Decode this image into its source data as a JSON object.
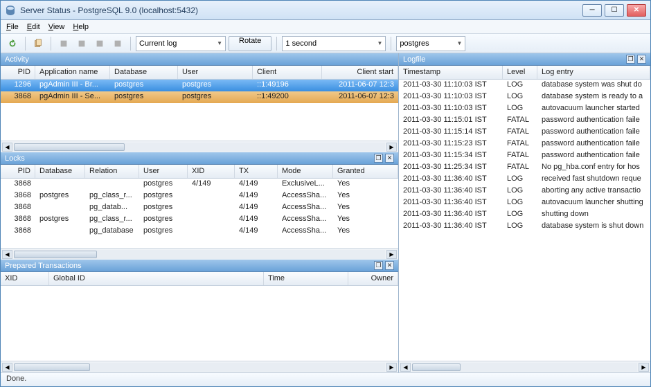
{
  "title": "Server Status - PostgreSQL 9.0 (localhost:5432)",
  "menu": {
    "file": "File",
    "edit": "Edit",
    "view": "View",
    "help": "Help"
  },
  "toolbar": {
    "currentlog": "Current log",
    "rotate": "Rotate",
    "refresh": "1 second",
    "database": "postgres"
  },
  "panels": {
    "activity": {
      "title": "Activity",
      "cols": [
        "PID",
        "Application name",
        "Database",
        "User",
        "Client",
        "Client start"
      ],
      "rows": [
        {
          "pid": "1296",
          "app": "pgAdmin III - Br...",
          "db": "postgres",
          "user": "postgres",
          "client": "::1:49196",
          "start": "2011-06-07 12:3"
        },
        {
          "pid": "3868",
          "app": "pgAdmin III - Se...",
          "db": "postgres",
          "user": "postgres",
          "client": "::1:49200",
          "start": "2011-06-07 12:3"
        }
      ]
    },
    "locks": {
      "title": "Locks",
      "cols": [
        "PID",
        "Database",
        "Relation",
        "User",
        "XID",
        "TX",
        "Mode",
        "Granted"
      ],
      "rows": [
        {
          "pid": "3868",
          "db": "",
          "rel": "",
          "user": "postgres",
          "xid": "4/149",
          "tx": "4/149",
          "mode": "ExclusiveL...",
          "granted": "Yes"
        },
        {
          "pid": "3868",
          "db": "postgres",
          "rel": "pg_class_r...",
          "user": "postgres",
          "xid": "",
          "tx": "4/149",
          "mode": "AccessSha...",
          "granted": "Yes"
        },
        {
          "pid": "3868",
          "db": "",
          "rel": "pg_datab...",
          "user": "postgres",
          "xid": "",
          "tx": "4/149",
          "mode": "AccessSha...",
          "granted": "Yes"
        },
        {
          "pid": "3868",
          "db": "postgres",
          "rel": "pg_class_r...",
          "user": "postgres",
          "xid": "",
          "tx": "4/149",
          "mode": "AccessSha...",
          "granted": "Yes"
        },
        {
          "pid": "3868",
          "db": "",
          "rel": "pg_database",
          "user": "postgres",
          "xid": "",
          "tx": "4/149",
          "mode": "AccessSha...",
          "granted": "Yes"
        }
      ]
    },
    "prepared": {
      "title": "Prepared Transactions",
      "cols": [
        "XID",
        "Global ID",
        "Time",
        "Owner"
      ],
      "rows": []
    },
    "logfile": {
      "title": "Logfile",
      "cols": [
        "Timestamp",
        "Level",
        "Log entry"
      ],
      "rows": [
        {
          "ts": "2011-03-30 11:10:03 IST",
          "lvl": "LOG",
          "msg": "database system was shut do"
        },
        {
          "ts": "2011-03-30 11:10:03 IST",
          "lvl": "LOG",
          "msg": "database system is ready to a"
        },
        {
          "ts": "2011-03-30 11:10:03 IST",
          "lvl": "LOG",
          "msg": "autovacuum launcher started"
        },
        {
          "ts": "2011-03-30 11:15:01 IST",
          "lvl": "FATAL",
          "msg": "password authentication faile"
        },
        {
          "ts": "2011-03-30 11:15:14 IST",
          "lvl": "FATAL",
          "msg": "password authentication faile"
        },
        {
          "ts": "2011-03-30 11:15:23 IST",
          "lvl": "FATAL",
          "msg": "password authentication faile"
        },
        {
          "ts": "2011-03-30 11:15:34 IST",
          "lvl": "FATAL",
          "msg": "password authentication faile"
        },
        {
          "ts": "2011-03-30 11:25:34 IST",
          "lvl": "FATAL",
          "msg": "No pg_hba.conf entry for hos"
        },
        {
          "ts": "2011-03-30 11:36:40 IST",
          "lvl": "LOG",
          "msg": "received fast shutdown reque"
        },
        {
          "ts": "2011-03-30 11:36:40 IST",
          "lvl": "LOG",
          "msg": "aborting any active transactio"
        },
        {
          "ts": "2011-03-30 11:36:40 IST",
          "lvl": "LOG",
          "msg": "autovacuum launcher shutting"
        },
        {
          "ts": "2011-03-30 11:36:40 IST",
          "lvl": "LOG",
          "msg": "shutting down"
        },
        {
          "ts": "2011-03-30 11:36:40 IST",
          "lvl": "LOG",
          "msg": "database system is shut down"
        }
      ]
    }
  },
  "status": "Done."
}
